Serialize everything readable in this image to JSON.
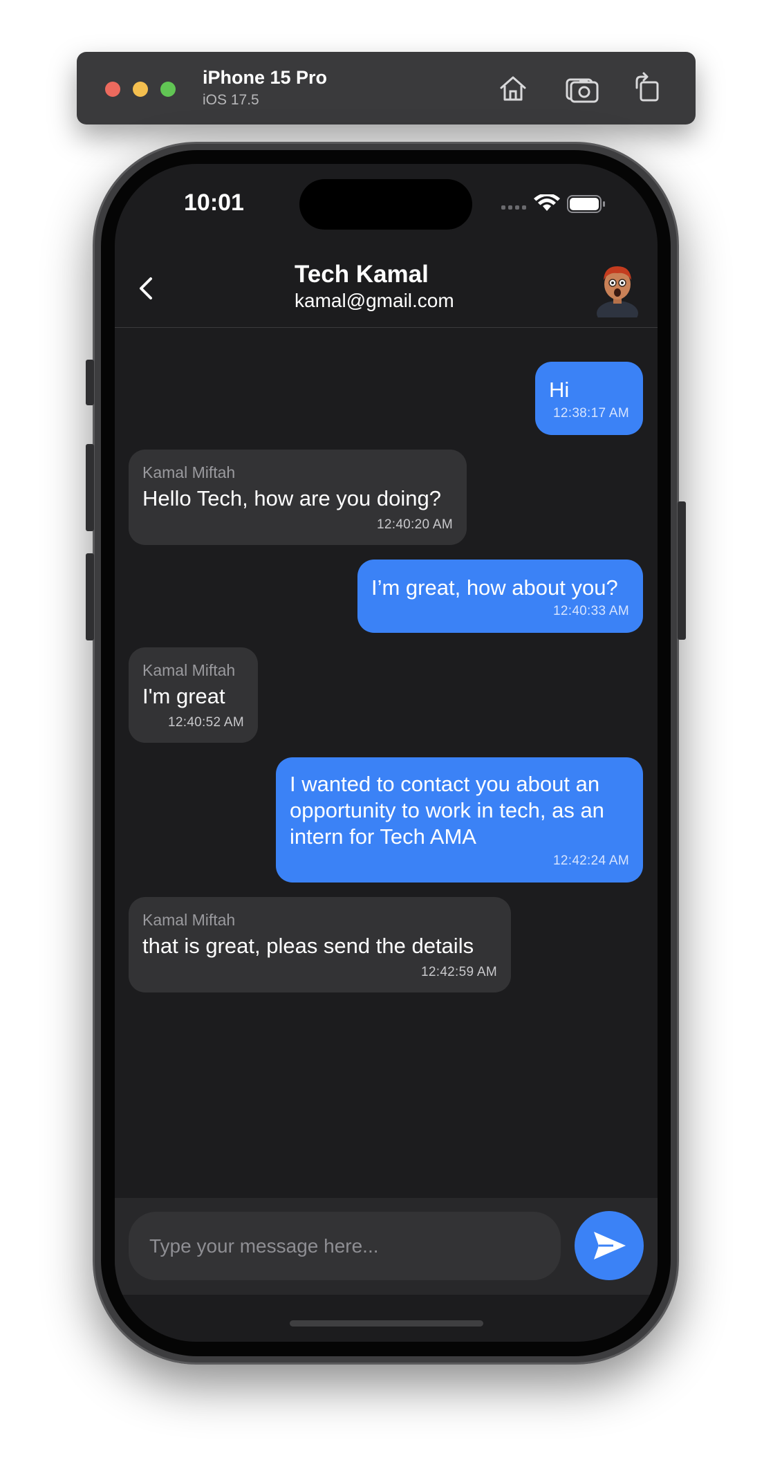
{
  "simulator": {
    "device_name": "iPhone 15 Pro",
    "os_version": "iOS 17.5",
    "toolbar_icons": [
      "home-icon",
      "screenshot-icon",
      "rotate-icon"
    ]
  },
  "status_bar": {
    "time": "10:01",
    "icons": [
      "signal-icon",
      "wifi-icon",
      "battery-icon"
    ]
  },
  "header": {
    "name": "Tech Kamal",
    "email": "kamal@gmail.com",
    "back_icon": "chevron-left-icon",
    "avatar_icon": "avatar-icon"
  },
  "messages": [
    {
      "direction": "out",
      "sender": "",
      "text": "Hi",
      "time": "12:38:17 AM"
    },
    {
      "direction": "in",
      "sender": "Kamal Miftah",
      "text": "Hello Tech, how are you doing?",
      "time": "12:40:20 AM"
    },
    {
      "direction": "out",
      "sender": "",
      "text": "I’m great, how about you?",
      "time": "12:40:33 AM"
    },
    {
      "direction": "in",
      "sender": "Kamal Miftah",
      "text": "I'm great",
      "time": "12:40:52 AM"
    },
    {
      "direction": "out",
      "sender": "",
      "text": "I wanted to contact you about an opportunity to work in tech, as an intern for Tech AMA",
      "time": "12:42:24 AM"
    },
    {
      "direction": "in",
      "sender": "Kamal Miftah",
      "text": "that is great, pleas send the details",
      "time": "12:42:59 AM"
    }
  ],
  "composer": {
    "placeholder": "Type your message here...",
    "value": "",
    "send_icon": "send-icon"
  },
  "colors": {
    "accent": "#3b82f6",
    "background": "#1c1c1e",
    "incoming_bubble": "#333335"
  }
}
